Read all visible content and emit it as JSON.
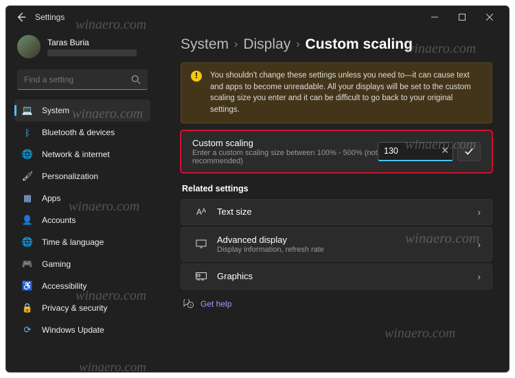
{
  "window": {
    "title": "Settings"
  },
  "user": {
    "name": "Taras Buria"
  },
  "search": {
    "placeholder": "Find a setting"
  },
  "sidebar": {
    "items": [
      {
        "label": "System",
        "icon": "💻"
      },
      {
        "label": "Bluetooth & devices",
        "icon": "ᛒ"
      },
      {
        "label": "Network & internet",
        "icon": "🌐"
      },
      {
        "label": "Personalization",
        "icon": "🖌"
      },
      {
        "label": "Apps",
        "icon": "▦"
      },
      {
        "label": "Accounts",
        "icon": "👤"
      },
      {
        "label": "Time & language",
        "icon": "🌐"
      },
      {
        "label": "Gaming",
        "icon": "🎮"
      },
      {
        "label": "Accessibility",
        "icon": "♿"
      },
      {
        "label": "Privacy & security",
        "icon": "🔒"
      },
      {
        "label": "Windows Update",
        "icon": "⟳"
      }
    ]
  },
  "breadcrumbs": {
    "a": "System",
    "b": "Display",
    "c": "Custom scaling"
  },
  "warning": {
    "text": "You shouldn't change these settings unless you need to—it can cause text and apps to become unreadable. All your displays will be set to the custom scaling size you enter and it can be difficult to go back to your original settings."
  },
  "custom_scaling": {
    "title": "Custom scaling",
    "subtitle": "Enter a custom scaling size between 100% - 500% (not recommended)",
    "value": "130"
  },
  "related": {
    "header": "Related settings",
    "text_size": {
      "title": "Text size"
    },
    "advanced": {
      "title": "Advanced display",
      "sub": "Display information, refresh rate"
    },
    "graphics": {
      "title": "Graphics"
    }
  },
  "help": {
    "label": "Get help"
  },
  "watermark": "winaero.com"
}
